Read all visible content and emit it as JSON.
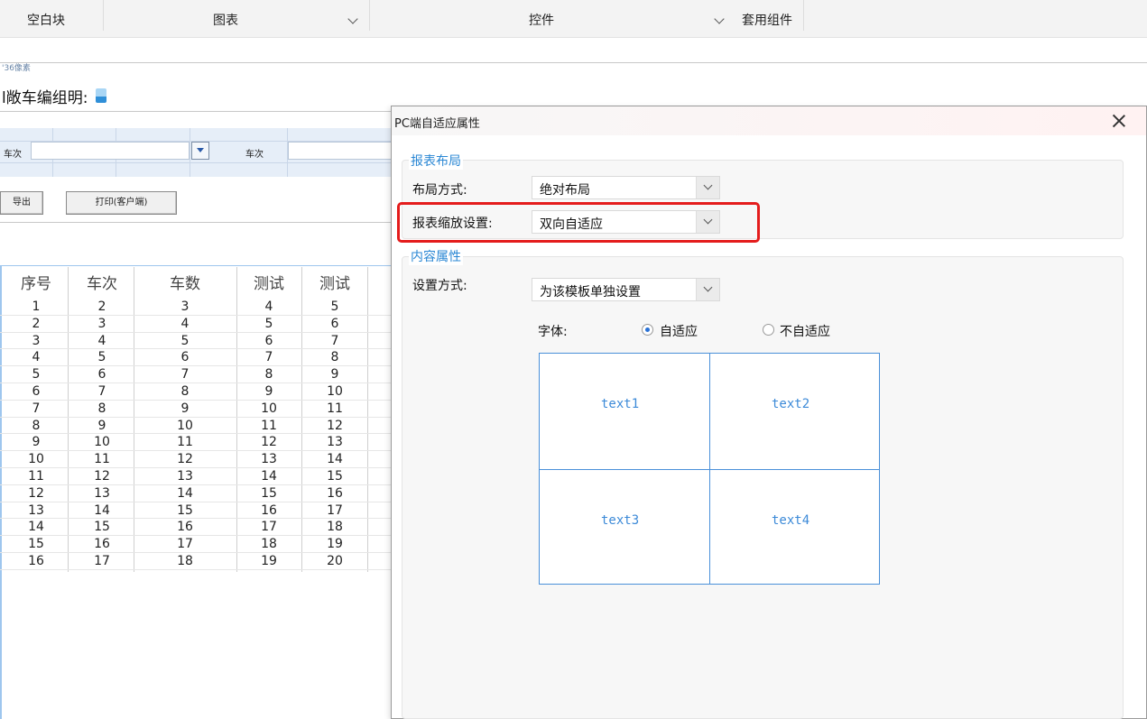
{
  "toolbar": {
    "blank_block": "空白块",
    "chart": "图表",
    "widget": "控件",
    "template_components": "套用组件"
  },
  "ruler_label": "'36像素",
  "report": {
    "title": "l敞车编组明:",
    "params": {
      "train_label_1": "车次",
      "train_label_2": "车次",
      "train_value_1": "",
      "train_value_2": ""
    },
    "buttons": {
      "export": "导出",
      "print": "打印(客户端)"
    },
    "table": {
      "headers": [
        "序号",
        "车次",
        "车数",
        "测试",
        "测试"
      ],
      "rows": [
        [
          "1",
          "2",
          "3",
          "4",
          "5"
        ],
        [
          "2",
          "3",
          "4",
          "5",
          "6"
        ],
        [
          "3",
          "4",
          "5",
          "6",
          "7"
        ],
        [
          "4",
          "5",
          "6",
          "7",
          "8"
        ],
        [
          "5",
          "6",
          "7",
          "8",
          "9"
        ],
        [
          "6",
          "7",
          "8",
          "9",
          "10"
        ],
        [
          "7",
          "8",
          "9",
          "10",
          "11"
        ],
        [
          "8",
          "9",
          "10",
          "11",
          "12"
        ],
        [
          "9",
          "10",
          "11",
          "12",
          "13"
        ],
        [
          "10",
          "11",
          "12",
          "13",
          "14"
        ],
        [
          "11",
          "12",
          "13",
          "14",
          "15"
        ],
        [
          "12",
          "13",
          "14",
          "15",
          "16"
        ],
        [
          "13",
          "14",
          "15",
          "16",
          "17"
        ],
        [
          "14",
          "15",
          "16",
          "17",
          "18"
        ],
        [
          "15",
          "16",
          "17",
          "18",
          "19"
        ],
        [
          "16",
          "17",
          "18",
          "19",
          "20"
        ]
      ]
    }
  },
  "dialog": {
    "title": "PC端自适应属性",
    "layout_group": {
      "legend": "报表布局",
      "layout_mode_label": "布局方式:",
      "layout_mode_value": "绝对布局",
      "scale_label": "报表缩放设置:",
      "scale_value": "双向自适应"
    },
    "content_group": {
      "legend": "内容属性",
      "setting_label": "设置方式:",
      "setting_value": "为该模板单独设置",
      "font_label": "字体:",
      "font_options": [
        {
          "label": "自适应",
          "selected": true
        },
        {
          "label": "不自适应",
          "selected": false
        }
      ],
      "preview_cells": [
        "text1",
        "text2",
        "text3",
        "text4"
      ]
    }
  },
  "colors": {
    "accent": "#2a87d4",
    "highlight": "#e41c1c",
    "preview_border": "#4a90d9"
  }
}
